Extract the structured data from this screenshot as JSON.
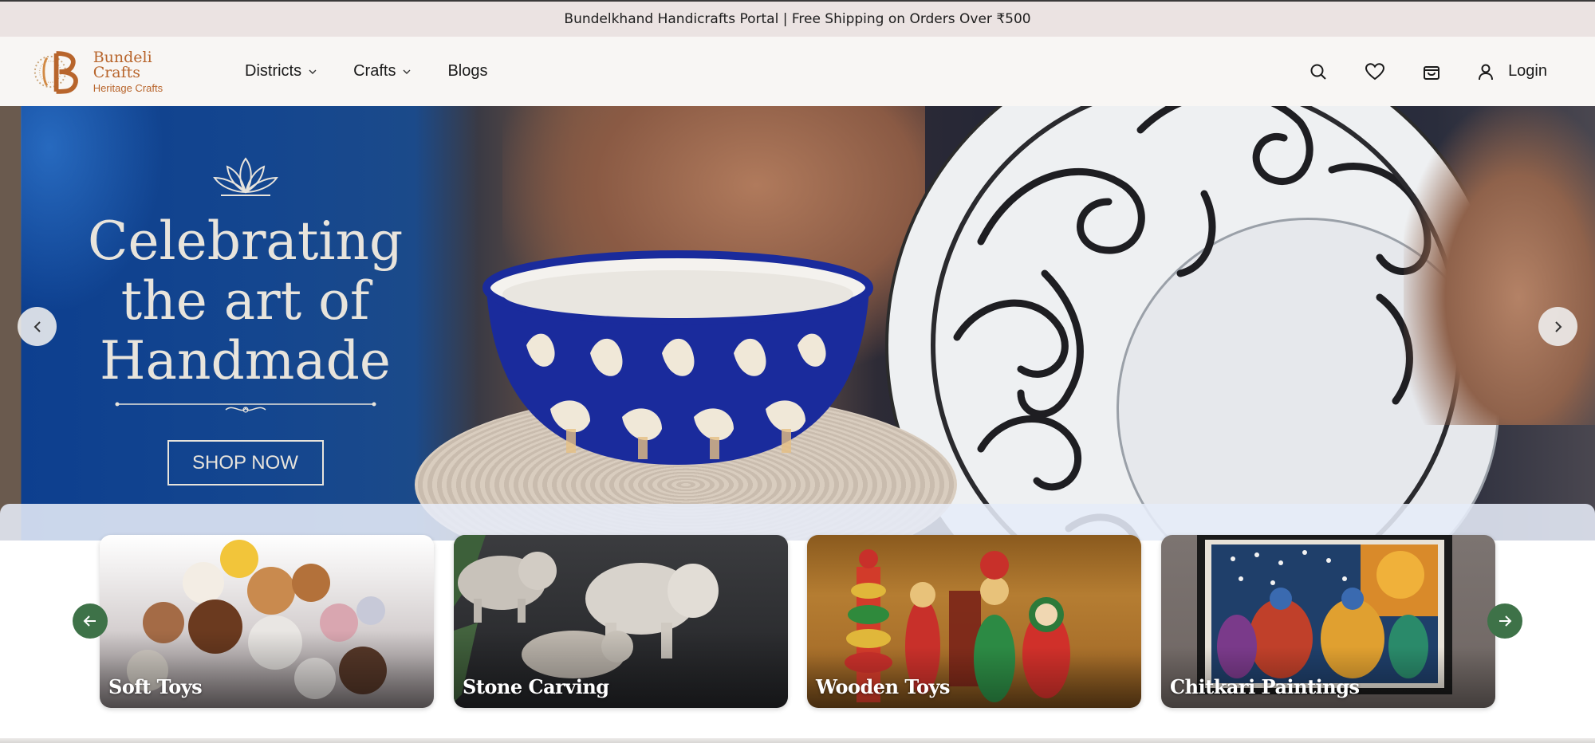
{
  "announcement": "Bundelkhand Handicrafts Portal | Free Shipping on Orders Over ₹500",
  "brand": {
    "name": "Bundeli Crafts",
    "tagline": "Heritage Crafts",
    "color": "#b8652c"
  },
  "nav": {
    "items": [
      {
        "label": "Districts",
        "has_dropdown": true
      },
      {
        "label": "Crafts",
        "has_dropdown": true
      },
      {
        "label": "Blogs",
        "has_dropdown": false
      }
    ]
  },
  "header_actions": {
    "icons": [
      "search-icon",
      "heart-icon",
      "shopping-bag-icon",
      "user-icon"
    ],
    "login_label": "Login"
  },
  "hero": {
    "title_lines": [
      "Celebrating",
      "the art of",
      "Handmade"
    ],
    "cta_label": "SHOP NOW"
  },
  "categories": {
    "items": [
      {
        "label": "Soft Toys"
      },
      {
        "label": "Stone Carving"
      },
      {
        "label": "Wooden Toys"
      },
      {
        "label": "Chitkari Paintings"
      }
    ],
    "accent": "#3e7248"
  }
}
